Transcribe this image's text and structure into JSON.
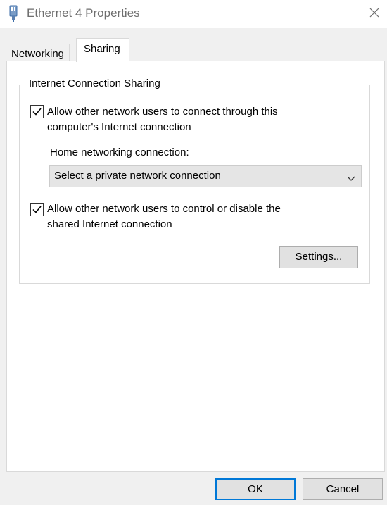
{
  "window": {
    "title": "Ethernet 4 Properties",
    "icon": "network-adapter-icon",
    "close_icon": "close-icon"
  },
  "tabs": [
    {
      "label": "Networking",
      "selected": false
    },
    {
      "label": "Sharing",
      "selected": true
    }
  ],
  "sharing": {
    "group_title": "Internet Connection Sharing",
    "allow_connect": {
      "line1": "Allow other network users to connect through this",
      "line2": "computer's Internet connection",
      "checked": true
    },
    "home_networking_label": "Home networking connection:",
    "home_networking_select": {
      "value": "Select a private network connection"
    },
    "allow_control": {
      "line1": "Allow other network users to control or disable the",
      "line2": "shared Internet connection",
      "checked": true
    },
    "settings_label": "Settings..."
  },
  "footer": {
    "ok_label": "OK",
    "cancel_label": "Cancel"
  },
  "colors": {
    "accent": "#0078d7",
    "button_face": "#e1e1e1",
    "dialog_bg": "#f0f0f0"
  }
}
